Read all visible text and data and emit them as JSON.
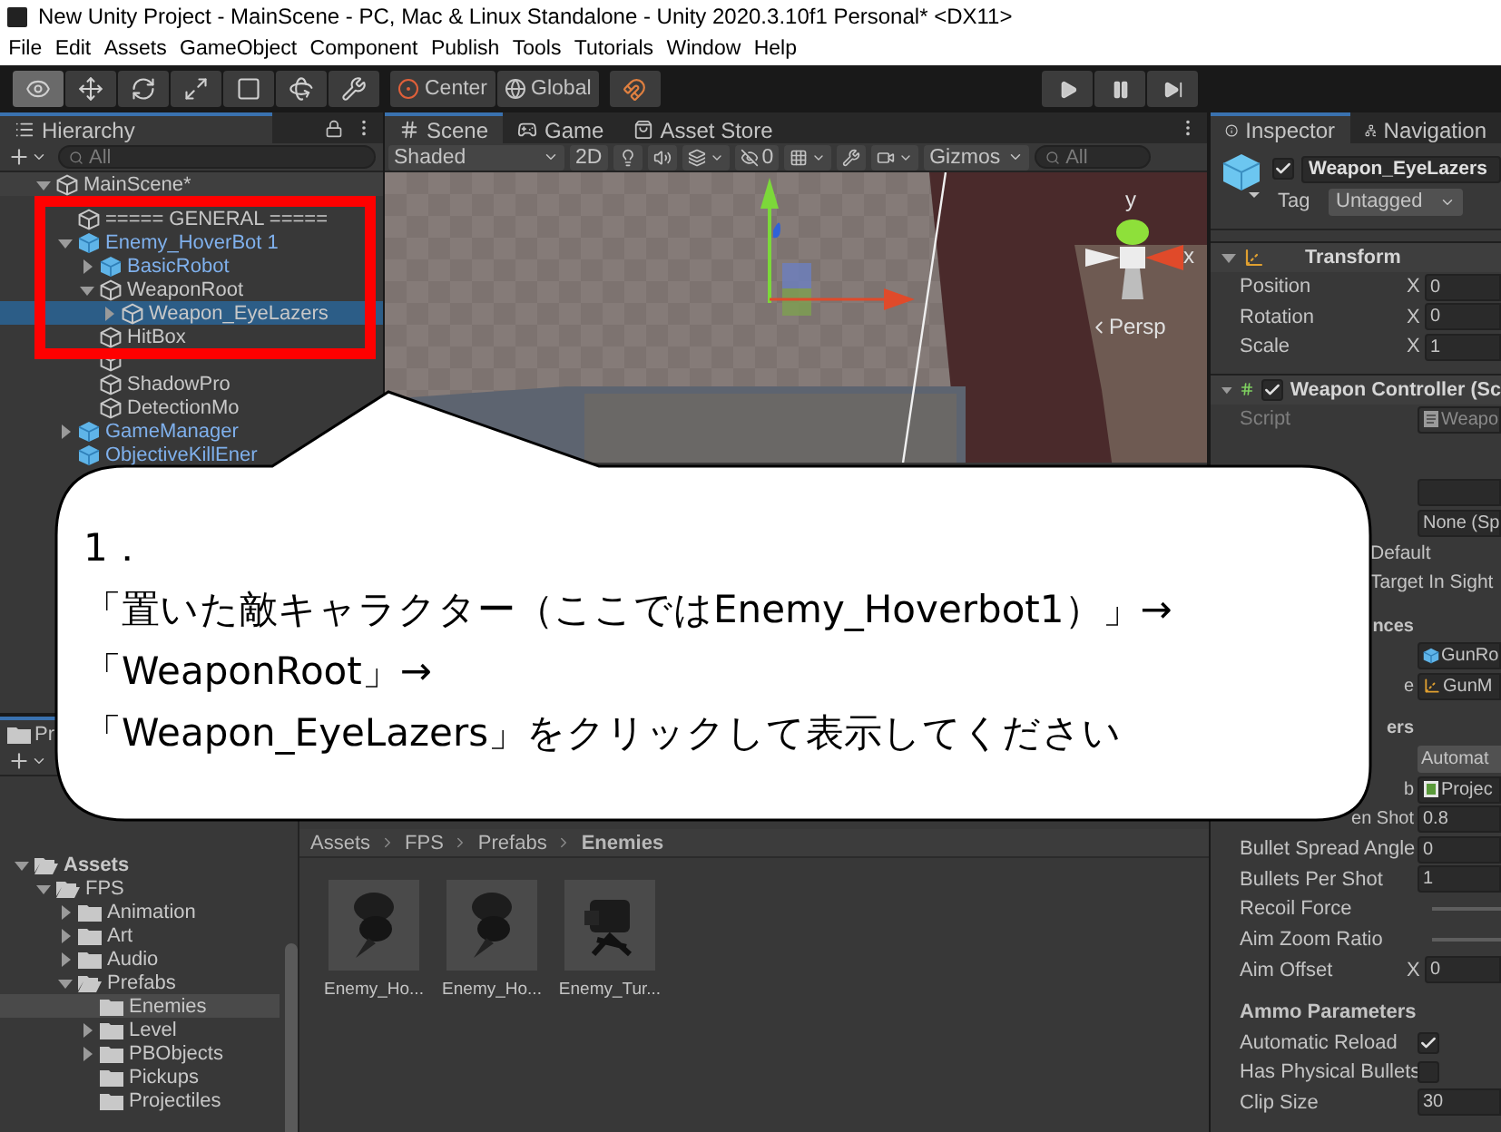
{
  "window": {
    "title": "New Unity Project - MainScene - PC, Mac & Linux Standalone - Unity 2020.3.10f1 Personal* <DX11>"
  },
  "menu": [
    "File",
    "Edit",
    "Assets",
    "GameObject",
    "Component",
    "Publish",
    "Tools",
    "Tutorials",
    "Window",
    "Help"
  ],
  "toolbar": {
    "tools": [
      {
        "kind": "view",
        "selected": true
      },
      {
        "kind": "move",
        "selected": false
      },
      {
        "kind": "rotate",
        "selected": false
      },
      {
        "kind": "scale",
        "selected": false
      },
      {
        "kind": "rect",
        "selected": false
      },
      {
        "kind": "transform",
        "selected": false
      },
      {
        "kind": "custom",
        "selected": false
      }
    ],
    "pivot": "Center",
    "space": "Global",
    "playback": [
      {
        "kind": "play"
      },
      {
        "kind": "pause"
      },
      {
        "kind": "step"
      }
    ]
  },
  "hierarchy": {
    "title": "Hierarchy",
    "search": {
      "placeholder": "All"
    },
    "scene": {
      "label": "MainScene*",
      "expanded": true
    },
    "items": [
      {
        "label": "===== GENERAL =====",
        "prefab": false
      },
      {
        "label": "Enemy_HoverBot 1",
        "prefab": true,
        "expanded": true,
        "selected": false,
        "children": [
          {
            "label": "BasicRobot",
            "prefab": true,
            "expanded": false,
            "selected": false
          },
          {
            "label": "WeaponRoot",
            "prefab": false,
            "expanded": true,
            "selected": false,
            "children": [
              {
                "label": "Weapon_EyeLazers",
                "prefab": false,
                "expanded": false,
                "selected": true
              }
            ]
          },
          {
            "label": "HitBox",
            "prefab": false,
            "selected": false
          },
          {
            "prefab": false
          },
          {
            "label": "ShadowPro",
            "prefab": false,
            "selected": false
          },
          {
            "label": "DetectionMo",
            "prefab": false,
            "selected": false
          }
        ]
      },
      {
        "label": "GameManager",
        "prefab": true,
        "expanded": false,
        "selected": false
      },
      {
        "label": "ObjectiveKillEner",
        "prefab": true,
        "selected": false
      }
    ]
  },
  "scene": {
    "tabs": [
      {
        "label": "Scene",
        "kind": "scene",
        "selected": true
      },
      {
        "label": "Game",
        "kind": "game",
        "selected": false
      },
      {
        "label": "Asset Store",
        "kind": "store",
        "selected": false
      }
    ],
    "shading": "Shaded",
    "mode_2d": "2D",
    "hidden_count": "0",
    "gizmos": "Gizmos",
    "search": {
      "placeholder": "All"
    },
    "axis_y": "y",
    "axis_x": "x",
    "view": "Persp"
  },
  "project": {
    "title": "Pr",
    "tree": [
      {
        "label": "Assets",
        "expanded": true,
        "children": [
          {
            "label": "FPS",
            "expanded": true,
            "children": [
              {
                "label": "Animation",
                "expanded": false
              },
              {
                "label": "Art",
                "expanded": false
              },
              {
                "label": "Audio",
                "expanded": false
              },
              {
                "label": "Prefabs",
                "expanded": true,
                "children": [
                  {
                    "label": "Enemies",
                    "selected": true
                  },
                  {
                    "label": "Level",
                    "expanded": false,
                    "selected": false
                  },
                  {
                    "label": "PBObjects",
                    "expanded": false,
                    "selected": false
                  },
                  {
                    "label": "Pickups",
                    "selected": false
                  },
                  {
                    "label": "Projectiles",
                    "selected": false
                  }
                ]
              }
            ]
          }
        ]
      }
    ],
    "breadcrumb": [
      "Assets",
      "FPS",
      "Prefabs",
      "Enemies"
    ],
    "assets": [
      {
        "label": "Enemy_Ho...",
        "kind": "hoverbot"
      },
      {
        "label": "Enemy_Ho...",
        "kind": "hoverbot"
      },
      {
        "label": "Enemy_Tur...",
        "kind": "turret"
      }
    ]
  },
  "inspector": {
    "tabs": [
      {
        "label": "Inspector",
        "kind": "info",
        "selected": true
      },
      {
        "label": "Navigation",
        "kind": "nav",
        "selected": false
      }
    ],
    "object": {
      "active": true,
      "name": "Weapon_EyeLazers",
      "tag_label": "Tag",
      "tag": "Untagged"
    },
    "components": [
      {
        "title": "Transform",
        "kind": "transform",
        "expanded": true,
        "rows": [
          {
            "kind": "vector",
            "label": "Position",
            "axis": "X",
            "value": "0"
          },
          {
            "kind": "vector",
            "label": "Rotation",
            "axis": "X",
            "value": "0"
          },
          {
            "kind": "vector",
            "label": "Scale",
            "axis": "X",
            "value": "1"
          }
        ]
      },
      {
        "title": "Weapon Controller (Sc",
        "kind": "script",
        "enabled": true,
        "expanded": true,
        "rows": [
          {
            "kind": "script_ref",
            "label": "Script",
            "value": "Weapo",
            "disabled": true
          },
          {
            "kind": "field"
          },
          {
            "kind": "field",
            "value": "None (Sp"
          },
          {
            "kind": "overflow",
            "label": "Default"
          },
          {
            "kind": "overflow",
            "label": "Target In Sight"
          },
          {
            "kind": "section",
            "label": "nces",
            "cut": true
          },
          {
            "kind": "prefab_ref",
            "value": "GunRo"
          },
          {
            "kind": "transform_ref",
            "label": "e",
            "cut": true,
            "value": "GunM"
          },
          {
            "kind": "section",
            "label": "ers",
            "cut": true
          },
          {
            "kind": "dropdown",
            "value": "Automat"
          },
          {
            "kind": "asset_ref",
            "label": "b",
            "cut": true,
            "value": "Projec"
          },
          {
            "kind": "field",
            "label": "en Shot",
            "cut": true,
            "value": "0.8"
          },
          {
            "kind": "field",
            "label": "Bullet Spread Angle",
            "value": "0"
          },
          {
            "kind": "field",
            "label": "Bullets Per Shot",
            "value": "1"
          },
          {
            "kind": "slider",
            "label": "Recoil Force"
          },
          {
            "kind": "slider",
            "label": "Aim Zoom Ratio"
          },
          {
            "kind": "vector",
            "label": "Aim Offset",
            "axis": "X",
            "value": "0"
          },
          {
            "kind": "section",
            "label": "Ammo Parameters"
          },
          {
            "kind": "checkbox",
            "label": "Automatic Reload",
            "checked": true
          },
          {
            "kind": "checkbox",
            "label": "Has Physical Bullets",
            "checked": false
          },
          {
            "kind": "field",
            "label": "Clip Size",
            "value": "30"
          }
        ]
      }
    ]
  },
  "callout": {
    "lines": [
      "1．",
      "「置いた敵キャラクター（ここではEnemy_Hoverbot1）」→",
      "「WeaponRoot」→",
      "「Weapon_EyeLazers」をクリックして表示してください"
    ]
  }
}
